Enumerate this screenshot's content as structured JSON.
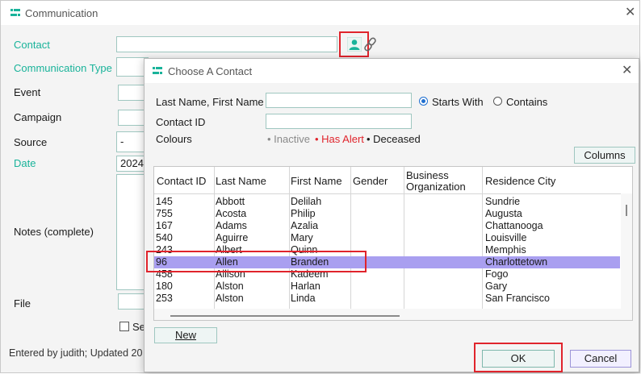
{
  "main": {
    "title": "Communication",
    "labels": {
      "contact": "Contact",
      "comm_type": "Communication Type",
      "event": "Event",
      "campaign": "Campaign",
      "source": "Source",
      "date": "Date",
      "notes": "Notes (complete)",
      "file": "File"
    },
    "source_value": "-",
    "date_value": "2024-",
    "checkbox_label": "Se",
    "footer": "Entered by judith; Updated 20"
  },
  "dialog": {
    "title": "Choose A Contact",
    "name_label": "Last Name, First Name",
    "id_label": "Contact ID",
    "colours_label": "Colours",
    "radio_starts": "Starts With",
    "radio_contains": "Contains",
    "legend_inactive": "• Inactive",
    "legend_alert": "• Has Alert",
    "legend_deceased": "• Deceased",
    "columns_button": "Columns",
    "new_button": "New",
    "ok_button": "OK",
    "cancel_button": "Cancel",
    "colors": {
      "inactive": "#8a8a8a",
      "alert": "#e0242c",
      "deceased": "#1a1a1a",
      "selected_row": "#a99ff0"
    },
    "headers": {
      "contact_id": "Contact ID",
      "last_name": "Last Name",
      "first_name": "First Name",
      "gender": "Gender",
      "business_1": "Business",
      "business_2": "Organization",
      "city": "Residence City"
    },
    "rows": [
      {
        "id": "145",
        "last": "Abbott",
        "first": "Delilah",
        "city": "Sundrie"
      },
      {
        "id": "755",
        "last": "Acosta",
        "first": "Philip",
        "city": "Augusta"
      },
      {
        "id": "167",
        "last": "Adams",
        "first": "Azalia",
        "city": "Chattanooga"
      },
      {
        "id": "540",
        "last": "Aguirre",
        "first": "Mary",
        "city": "Louisville"
      },
      {
        "id": "243",
        "last": "Albert",
        "first": "Quinn",
        "city": "Memphis"
      },
      {
        "id": "96",
        "last": "Allen",
        "first": "Branden",
        "city": "Charlottetown"
      },
      {
        "id": "458",
        "last": "Allison",
        "first": "Kadeem",
        "city": "Fogo"
      },
      {
        "id": "180",
        "last": "Alston",
        "first": "Harlan",
        "city": "Gary"
      },
      {
        "id": "253",
        "last": "Alston",
        "first": "Linda",
        "city": "San Francisco"
      }
    ]
  }
}
